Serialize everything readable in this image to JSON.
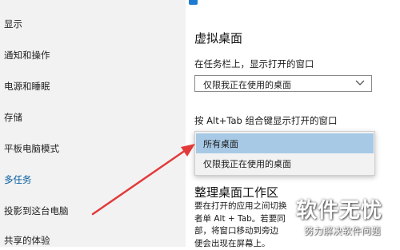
{
  "sidebar": {
    "items": [
      {
        "label": "显示"
      },
      {
        "label": "通知和操作"
      },
      {
        "label": "电源和睡眠"
      },
      {
        "label": "存储"
      },
      {
        "label": "平板电脑模式"
      },
      {
        "label": "多任务"
      },
      {
        "label": "投影到这台电脑"
      },
      {
        "label": "共享的体验"
      }
    ],
    "active_index": 5
  },
  "main": {
    "section_title": "虚拟桌面",
    "taskbar_label": "在任务栏上，显示打开的窗口",
    "taskbar_select_value": "仅限我正在使用的桌面",
    "alttab_label": "按 Alt+Tab 组合键显示打开的窗口",
    "alttab_options": [
      "所有桌面",
      "仅限我正在使用的桌面"
    ],
    "alttab_selected": "所有桌面",
    "section2_title": "整理桌面工作区",
    "desc_lines": [
      "要在打开的应用之间切换",
      "者单 Alt + Tab。若要同",
      "部，将窗口移动到旁边",
      "便会出现在屏幕上。"
    ]
  },
  "watermark": {
    "logo": "软件无忧",
    "sub": "努力解决软件问题"
  },
  "colors": {
    "sidebar_bg": "#f2f2f2",
    "active_nav": "#005a9e",
    "selected_option_bg": "#a7c9e6",
    "annotation_arrow": "#e23a3a"
  },
  "icons": {
    "dropdown": "chevron-down-icon",
    "annotation": "red-arrow-annotation"
  }
}
